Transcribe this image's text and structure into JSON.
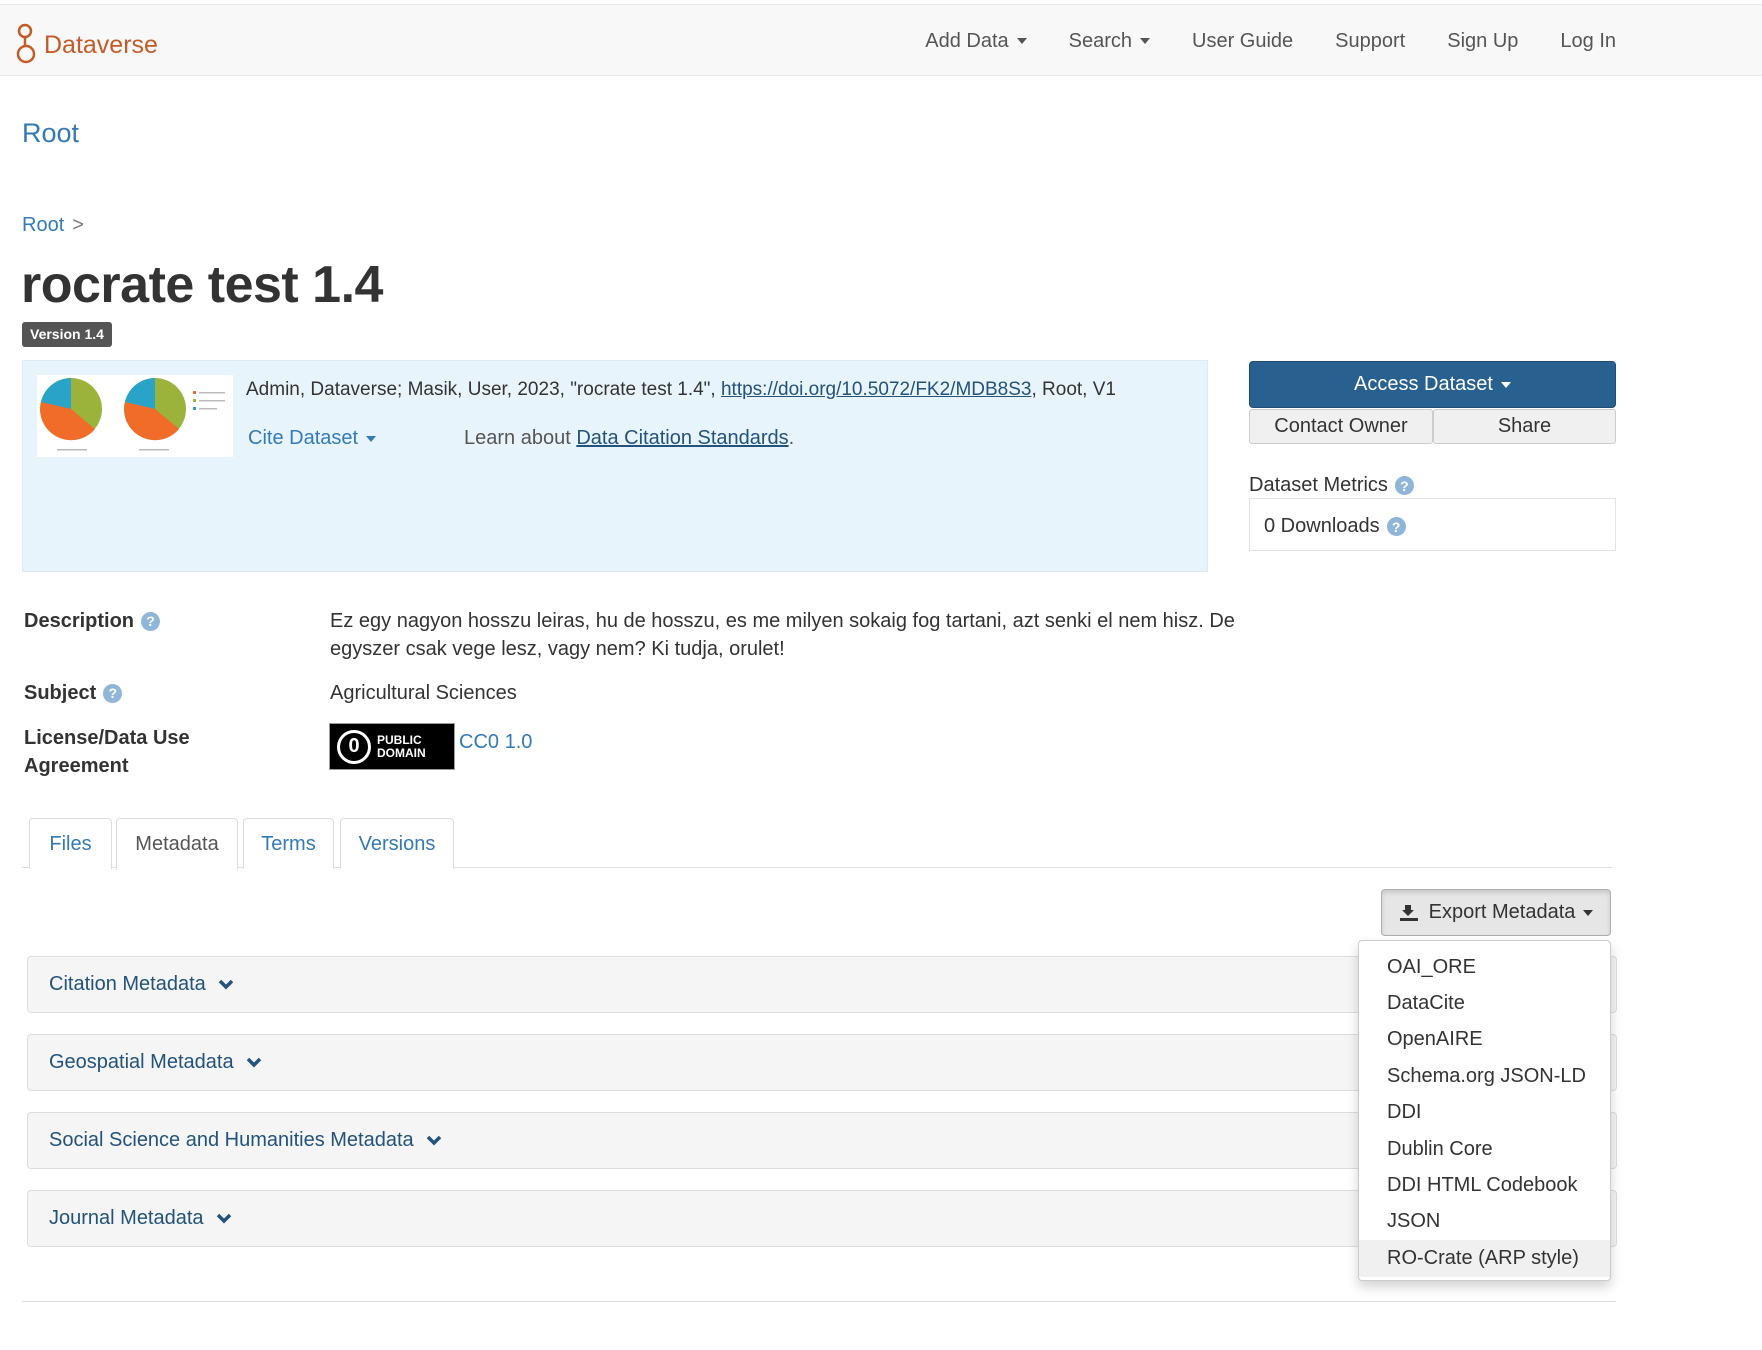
{
  "navbar": {
    "brand": "Dataverse",
    "items": [
      {
        "label": "Add Data",
        "dropdown": true
      },
      {
        "label": "Search",
        "dropdown": true
      },
      {
        "label": "User Guide",
        "dropdown": false
      },
      {
        "label": "Support",
        "dropdown": false
      },
      {
        "label": "Sign Up",
        "dropdown": false
      },
      {
        "label": "Log In",
        "dropdown": false
      }
    ]
  },
  "dataverse_name": "Root",
  "breadcrumb": {
    "root": "Root",
    "separator": ">"
  },
  "dataset": {
    "title": "rocrate test 1.4",
    "version_badge": "Version 1.4"
  },
  "citation": {
    "text_before": "Admin, Dataverse; Masik, User, 2023, \"rocrate test 1.4\", ",
    "doi": "https://doi.org/10.5072/FK2/MDB8S3",
    "text_after": ", Root, V1",
    "cite_button": "Cite Dataset",
    "learn_prefix": "Learn about ",
    "learn_link": "Data Citation Standards",
    "learn_suffix": "."
  },
  "actions": {
    "access": "Access Dataset",
    "contact": "Contact Owner",
    "share": "Share"
  },
  "metrics": {
    "title": "Dataset Metrics",
    "downloads": "0 Downloads"
  },
  "summary": {
    "description_label": "Description",
    "description_line1": "Ez egy nagyon hosszu leiras, hu de hosszu, es me milyen sokaig fog tartani, azt senki el nem hisz. De",
    "description_line2": "egyszer csak vege lesz, vagy nem? Ki tudja, orulet!",
    "subject_label": "Subject",
    "subject_value": "Agricultural Sciences",
    "license_label_line1": "License/Data Use",
    "license_label_line2": "Agreement",
    "license_badge_line1": "PUBLIC",
    "license_badge_line2": "DOMAIN",
    "license_link": "CC0 1.0"
  },
  "tabs": [
    {
      "label": "Files",
      "active": false
    },
    {
      "label": "Metadata",
      "active": true
    },
    {
      "label": "Terms",
      "active": false
    },
    {
      "label": "Versions",
      "active": false
    }
  ],
  "export": {
    "button": "Export Metadata",
    "options": [
      "OAI_ORE",
      "DataCite",
      "OpenAIRE",
      "Schema.org JSON-LD",
      "DDI",
      "Dublin Core",
      "DDI HTML Codebook",
      "JSON",
      "RO-Crate (ARP style)"
    ],
    "highlighted": "RO-Crate (ARP style)"
  },
  "metadata_blocks": [
    "Citation Metadata",
    "Geospatial Metadata",
    "Social Science and Humanities Metadata",
    "Journal Metadata"
  ],
  "colors": {
    "brand": "#c55b28",
    "link": "#337ab7",
    "primary_button": "#286090",
    "citation_bg": "#e8f4fb"
  }
}
